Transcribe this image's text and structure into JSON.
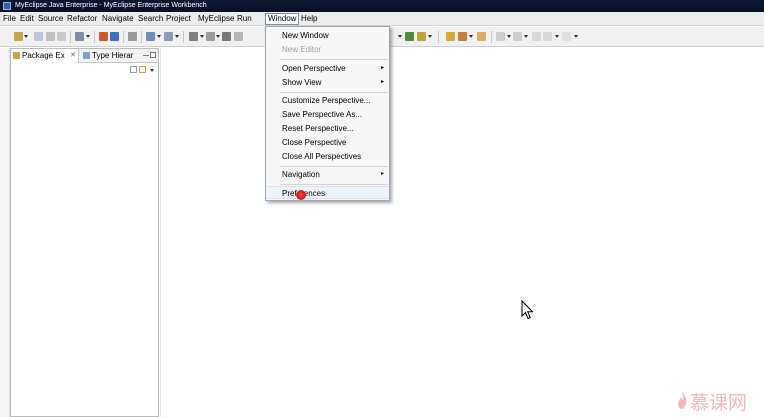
{
  "window": {
    "title": "MyEclipse Java Enterprise - MyEclipse Enterprise Workbench"
  },
  "menubar": {
    "items": [
      "File",
      "Edit",
      "Source",
      "Refactor",
      "Navigate",
      "Search",
      "Project",
      "MyEclipse",
      "Run",
      "Window",
      "Help"
    ],
    "active": "Window"
  },
  "views": {
    "tabs": [
      {
        "label": "Package Ex",
        "icon": "package-explorer-icon"
      },
      {
        "label": "Type Hierar",
        "icon": "type-hierarchy-icon"
      }
    ]
  },
  "window_menu": {
    "items": [
      {
        "label": "New Window",
        "enabled": true
      },
      {
        "label": "New Editor",
        "enabled": false
      },
      {
        "label": "Open Perspective",
        "enabled": true,
        "submenu": true
      },
      {
        "label": "Show View",
        "enabled": true,
        "submenu": true
      },
      {
        "label": "Customize Perspective...",
        "enabled": true
      },
      {
        "label": "Save Perspective As...",
        "enabled": true
      },
      {
        "label": "Reset Perspective...",
        "enabled": true
      },
      {
        "label": "Close Perspective",
        "enabled": true
      },
      {
        "label": "Close All Perspectives",
        "enabled": true
      },
      {
        "label": "Navigation",
        "enabled": true,
        "submenu": true
      },
      {
        "label": "Preferences",
        "enabled": true,
        "hovered": true
      }
    ],
    "submenu_glyph": "▸"
  },
  "watermark": {
    "text": "慕课网"
  }
}
